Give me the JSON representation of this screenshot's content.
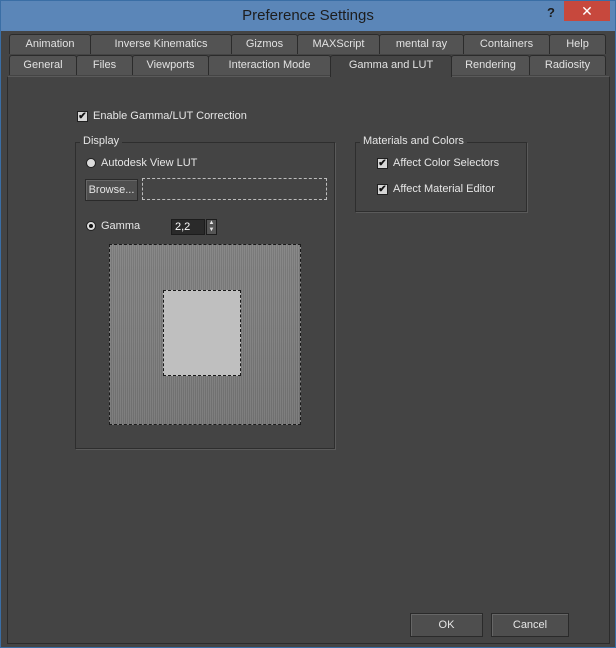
{
  "window": {
    "title": "Preference Settings",
    "help_glyph": "?",
    "close_glyph": "✕"
  },
  "tabs": {
    "row1": [
      "Animation",
      "Inverse Kinematics",
      "Gizmos",
      "MAXScript",
      "mental ray",
      "Containers",
      "Help"
    ],
    "row2": [
      "General",
      "Files",
      "Viewports",
      "Interaction Mode",
      "Gamma and LUT",
      "Rendering",
      "Radiosity"
    ],
    "active": "Gamma and LUT"
  },
  "gamma_lut": {
    "enable_label": "Enable Gamma/LUT Correction",
    "enable_checked": true,
    "display": {
      "group_title": "Display",
      "view_lut_label": "Autodesk View LUT",
      "view_lut_selected": false,
      "browse_label": "Browse...",
      "lut_path": "",
      "gamma_label": "Gamma",
      "gamma_selected": true,
      "gamma_value": "2,2"
    },
    "materials": {
      "group_title": "Materials and Colors",
      "affect_color_label": "Affect Color Selectors",
      "affect_color_checked": true,
      "affect_material_label": "Affect Material Editor",
      "affect_material_checked": true
    }
  },
  "footer": {
    "ok_label": "OK",
    "cancel_label": "Cancel"
  },
  "icons": {
    "check": "✔",
    "spinner_up": "▲",
    "spinner_down": "▼"
  }
}
